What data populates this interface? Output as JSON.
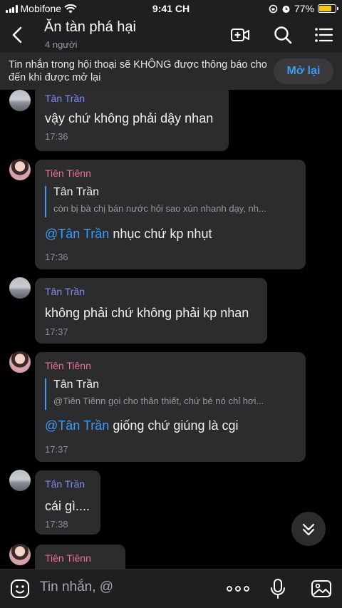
{
  "status_bar": {
    "carrier": "Mobifone",
    "time": "9:41 CH",
    "battery": "77%",
    "battery_level": 0.77,
    "battery_color": "#f5c51b"
  },
  "header": {
    "title": "Ăn tàn phá hại",
    "subtitle": "4 người"
  },
  "banner": {
    "text": "Tin nhắn trong hội thoại sẽ KHÔNG được thông báo cho đến khi được mở lại",
    "button": "Mở lại"
  },
  "colors": {
    "accent": "#3d9cf5",
    "sender_tan": "#7e8ef2",
    "sender_tien": "#ef6f8c",
    "bubble": "#2c2c2e"
  },
  "messages": [
    {
      "sender": "Tân Trần",
      "text": "vậy chứ không phải dậy nhan",
      "time": "17:36"
    },
    {
      "sender": "Tiên Tiênn",
      "quote_name": "Tân Trần",
      "quote_text": "còn bị bà chị bán nước hỏi sao xún nhanh dạy, nh...",
      "mention": "@Tân Trần",
      "text": " nhục chứ kp nhụt",
      "time": "17:36"
    },
    {
      "sender": "Tân Trần",
      "text": "không phải chứ không phải kp nhan",
      "time": "17:37"
    },
    {
      "sender": "Tiên Tiênn",
      "quote_name": "Tân Trần",
      "quote_text": "@Tiên Tiênn gọi cho thân thiết, chứ bé nó chỉ hơi...",
      "mention": "@Tân Trần",
      "text": " giống chứ giúng là cgi",
      "time": "17:37"
    },
    {
      "sender": "Tân Trần",
      "text": "cái gì....",
      "time": "17:38"
    },
    {
      "sender": "Tiên Tiênn"
    }
  ],
  "input": {
    "placeholder": "Tin nhắn, @"
  },
  "icons": [
    "back-arrow-icon",
    "video-call-icon",
    "search-icon",
    "menu-list-icon",
    "chevron-down-icon",
    "sticker-icon",
    "more-icon",
    "microphone-icon",
    "image-icon",
    "wifi-icon",
    "alarm-icon",
    "lock-rotation-icon"
  ]
}
